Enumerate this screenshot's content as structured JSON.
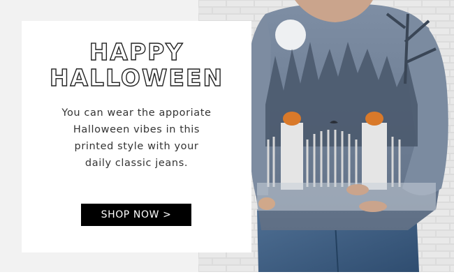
{
  "promo": {
    "headline_line1": "HAPPY",
    "headline_line2": "HALLOWEEN",
    "description": "You can wear the apporiate Halloween vibes in this printed style with your daily classic jeans.",
    "cta_label": "SHOP NOW >"
  },
  "colors": {
    "cta_background": "#000000",
    "cta_text": "#ffffff",
    "left_background": "#f2f2f2",
    "sweater": "#6f7f93"
  },
  "icons": [
    "moon-icon",
    "pumpkin-icon",
    "bird-icon"
  ]
}
